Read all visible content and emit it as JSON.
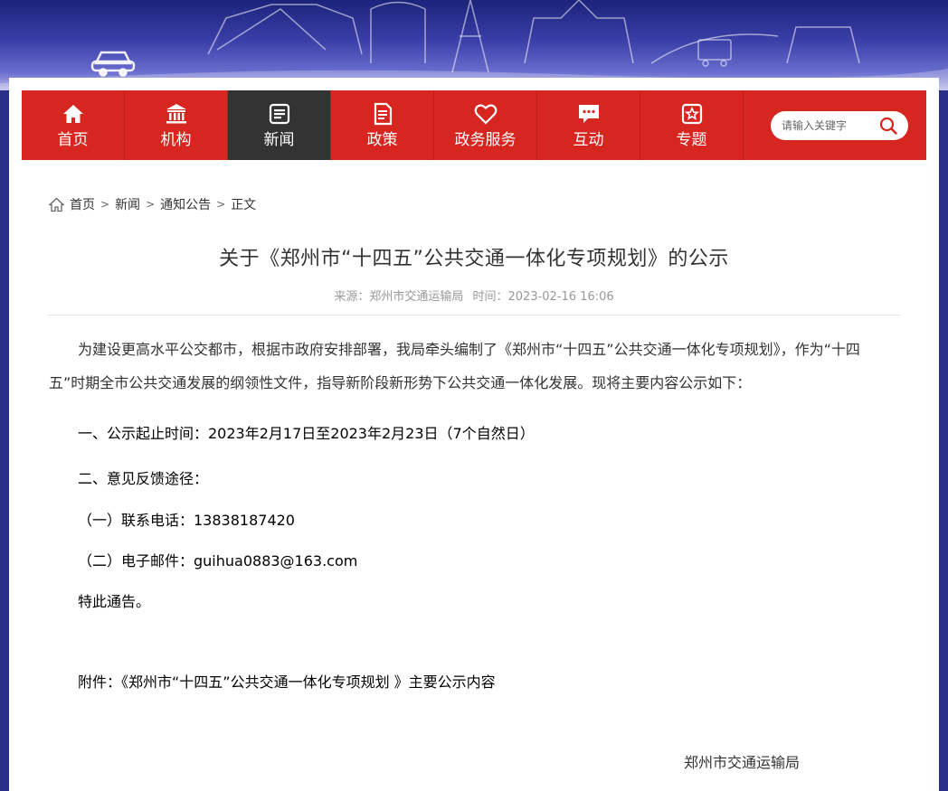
{
  "nav": {
    "items": [
      {
        "label": "首页",
        "icon": "home-icon"
      },
      {
        "label": "机构",
        "icon": "institution-icon"
      },
      {
        "label": "新闻",
        "icon": "news-icon"
      },
      {
        "label": "政策",
        "icon": "policy-icon"
      },
      {
        "label": "政务服务",
        "icon": "heart-icon"
      },
      {
        "label": "互动",
        "icon": "chat-icon"
      },
      {
        "label": "专题",
        "icon": "star-icon"
      }
    ],
    "active": "新闻",
    "search_placeholder": "请输入关键字"
  },
  "breadcrumb": [
    "首页",
    "新闻",
    "通知公告",
    "正文"
  ],
  "article": {
    "title": "关于《郑州市“十四五”公共交通一体化专项规划》的公示",
    "source": "来源：郑州市交通运输局",
    "time": "时间：2023-02-16 16:06",
    "paragraph1": "为建设更高水平公交都市，根据市政府安排部署，我局牵头编制了《郑州市“十四五”公共交通一体化专项规划》，作为“十四五”时期全市公共交通发展的纲领性文件，指导新阶段新形势下公共交通一体化发展。现将主要内容公示如下：",
    "line1": "一、公示起止时间：2023年2月17日至2023年2月23日（7个自然日）",
    "line2": "二、意见反馈途径：",
    "line3": "（一）联系电话：13838187420",
    "line4": "（二）电子邮件：guihua0883@163.com",
    "line5": "特此通告。",
    "attachment": "附件：《郑州市“十四五”公共交通一体化专项规划 》主要公示内容",
    "signature": "郑州市交通运输局"
  },
  "colors": {
    "nav_red": "#d7261f",
    "nav_active": "#333333",
    "banner": "#2a2f8a"
  }
}
